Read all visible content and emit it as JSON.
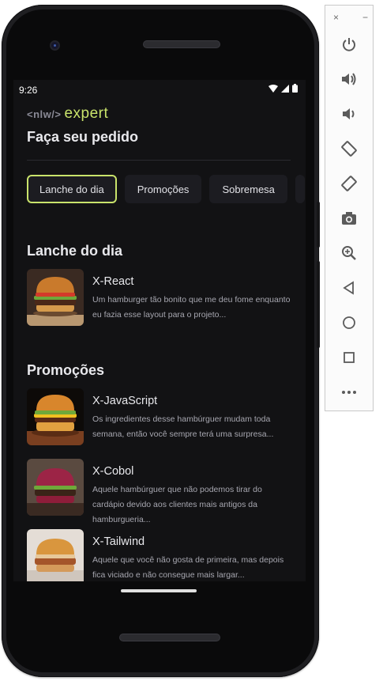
{
  "status_bar": {
    "time": "9:26"
  },
  "app": {
    "logo_code": "<nlw/>",
    "logo_word": "expert",
    "title": "Faça seu pedido",
    "tabs": [
      "Lanche do dia",
      "Promoções",
      "Sobremesa"
    ],
    "active_tab_index": 0,
    "sections": [
      {
        "title": "Lanche do dia",
        "items": [
          {
            "name": "X-React",
            "description": "Um hamburger tão bonito que me deu fome enquanto eu fazia esse layout para o projeto..."
          }
        ]
      },
      {
        "title": "Promoções",
        "items": [
          {
            "name": "X-JavaScript",
            "description": "Os ingredientes desse hambúrguer mudam toda semana, então você sempre terá uma surpresa..."
          },
          {
            "name": "X-Cobol",
            "description": "Aquele hambúrguer que não podemos tirar do cardápio devido aos clientes mais antigos da hamburgueria..."
          },
          {
            "name": "X-Tailwind",
            "description": "Aquele que você não gosta de primeira, mas depois fica viciado e não consegue mais largar..."
          }
        ]
      }
    ]
  },
  "emulator_toolbar": {
    "close_glyph": "×",
    "minimize_glyph": "−",
    "buttons": [
      "power-icon",
      "volume-up-icon",
      "volume-down-icon",
      "rotate-left-icon",
      "rotate-right-icon",
      "camera-icon",
      "zoom-icon",
      "back-icon",
      "home-icon",
      "overview-icon",
      "more-icon"
    ]
  },
  "colors": {
    "screen_bg": "#121214",
    "tab_bg": "#1c1c21",
    "accent": "#c9e36b",
    "text_primary": "#e8e8ec",
    "text_secondary": "#a7a7b0"
  }
}
